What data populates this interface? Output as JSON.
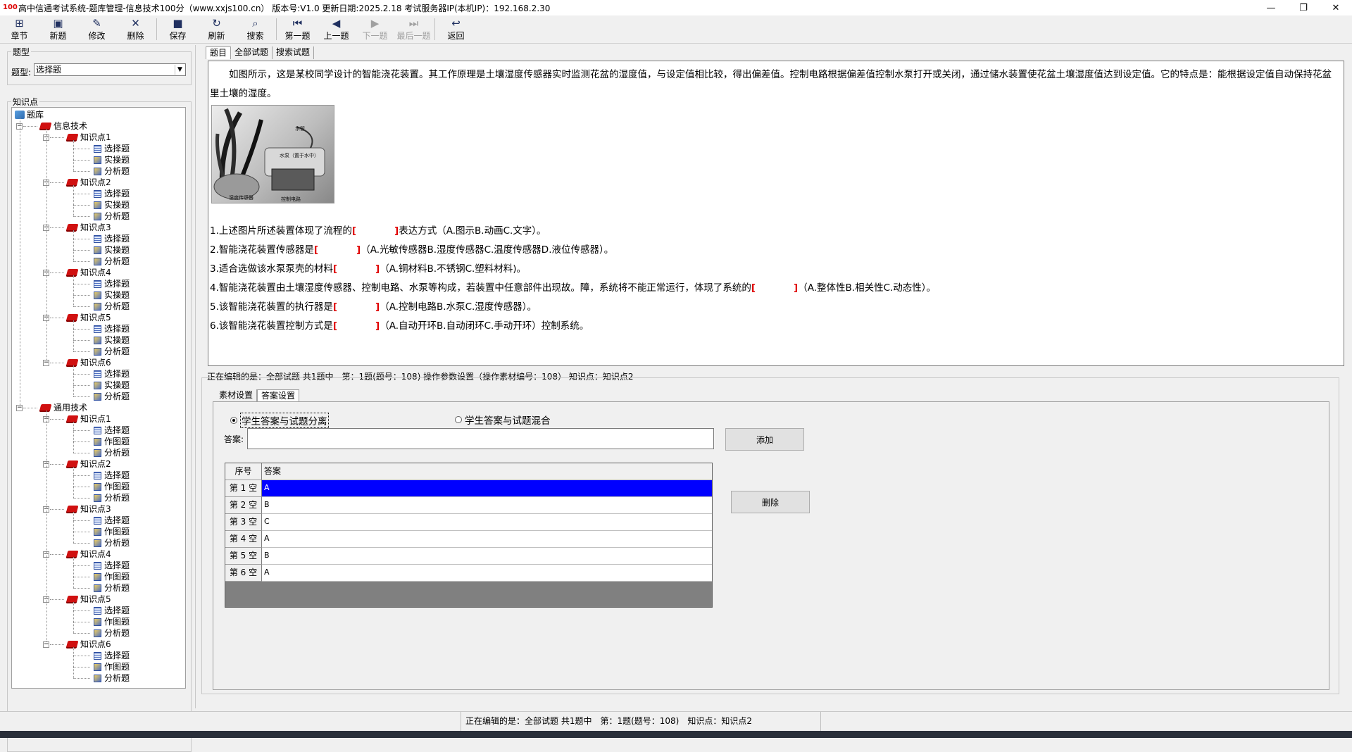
{
  "window": {
    "title": "高中信通考试系统-题库管理-信息技术100分（www.xxjs100.cn） 版本号:V1.0 更新日期:2025.2.18 考试服务器IP(本机IP)：192.168.2.30",
    "logo_text": "100",
    "minimize": "—",
    "maximize": "❐",
    "close": "✕"
  },
  "toolbar": {
    "items": [
      {
        "label": "章节",
        "icon": "chapter-icon",
        "glyph": "⊞"
      },
      {
        "label": "新题",
        "icon": "new-icon",
        "glyph": "▣"
      },
      {
        "label": "修改",
        "icon": "edit-icon",
        "glyph": "✎"
      },
      {
        "label": "删除",
        "icon": "delete-icon",
        "glyph": "✕"
      },
      {
        "label": "保存",
        "icon": "save-icon",
        "glyph": "■"
      },
      {
        "label": "刷新",
        "icon": "refresh-icon",
        "glyph": "↻"
      },
      {
        "label": "搜索",
        "icon": "search-icon",
        "glyph": "⌕"
      },
      {
        "label": "第一题",
        "icon": "first-icon",
        "glyph": "⏮"
      },
      {
        "label": "上一题",
        "icon": "prev-icon",
        "glyph": "◀"
      },
      {
        "label": "下一题",
        "icon": "next-icon",
        "glyph": "▶",
        "disabled": true
      },
      {
        "label": "最后一题",
        "icon": "last-icon",
        "glyph": "⏭",
        "disabled": true
      },
      {
        "label": "返回",
        "icon": "back-icon",
        "glyph": "↩"
      }
    ]
  },
  "left": {
    "type_group_label": "题型",
    "type_field_label": "题型:",
    "type_selected": "选择题",
    "knowledge_group_label": "知识点",
    "tree": {
      "root": "题库",
      "subjects": [
        {
          "name": "信息技术",
          "points": [
            {
              "name": "知识点1",
              "leaves": [
                "选择题",
                "实操题",
                "分析题"
              ]
            },
            {
              "name": "知识点2",
              "leaves": [
                "选择题",
                "实操题",
                "分析题"
              ]
            },
            {
              "name": "知识点3",
              "leaves": [
                "选择题",
                "实操题",
                "分析题"
              ]
            },
            {
              "name": "知识点4",
              "leaves": [
                "选择题",
                "实操题",
                "分析题"
              ]
            },
            {
              "name": "知识点5",
              "leaves": [
                "选择题",
                "实操题",
                "分析题"
              ]
            },
            {
              "name": "知识点6",
              "leaves": [
                "选择题",
                "实操题",
                "分析题"
              ]
            }
          ]
        },
        {
          "name": "通用技术",
          "points": [
            {
              "name": "知识点1",
              "leaves": [
                "选择题",
                "作图题",
                "分析题"
              ]
            },
            {
              "name": "知识点2",
              "leaves": [
                "选择题",
                "作图题",
                "分析题"
              ]
            },
            {
              "name": "知识点3",
              "leaves": [
                "选择题",
                "作图题",
                "分析题"
              ]
            },
            {
              "name": "知识点4",
              "leaves": [
                "选择题",
                "作图题",
                "分析题"
              ]
            },
            {
              "name": "知识点5",
              "leaves": [
                "选择题",
                "作图题",
                "分析题"
              ]
            },
            {
              "name": "知识点6",
              "leaves": [
                "选择题",
                "作图题",
                "分析题"
              ]
            }
          ]
        }
      ]
    }
  },
  "main_tabs": [
    "题目",
    "全部试题",
    "搜索试题"
  ],
  "question": {
    "intro": "如图所示，这是某校同学设计的智能浇花装置。其工作原理是土壤湿度传感器实时监测花盆的湿度值，与设定值相比较，得出偏差值。控制电路根据偏差值控制水泵打开或关闭，通过储水装置使花盆土壤湿度值达到设定值。它的特点是：能根据设定值自动保持花盆里土壤的湿度。",
    "image_captions": [
      "水管",
      "水泵（置于水中）",
      "湿度传感器",
      "控制电路"
    ],
    "items": [
      {
        "pre": "1.上述图片所述装置体现了流程的",
        "blank": "[　　　　]",
        "post": "表达方式（A.图示B.动画C.文字）。"
      },
      {
        "pre": "2.智能浇花装置传感器是",
        "blank": "[　　　　]",
        "post": "（A.光敏传感器B.湿度传感器C.温度传感器D.液位传感器）。"
      },
      {
        "pre": "3.适合选做该水泵泵壳的材料",
        "blank": "[　　　　]",
        "post": "（A.铜材料B.不锈钢C.塑料材料)。"
      },
      {
        "pre": "4.智能浇花装置由土壤湿度传感器、控制电路、水泵等构成，若装置中任意部件出现故。障，系统将不能正常运行，体现了系统的",
        "blank": "[　　　　]",
        "post": "（A.整体性B.相关性C.动态性）。"
      },
      {
        "pre": "5.该智能浇花装置的执行器是",
        "blank": "[　　　　]",
        "post": "（A.控制电路B.水泵C.湿度传感器）。"
      },
      {
        "pre": "6.该智能浇花装置控制方式是",
        "blank": "[　　　　]",
        "post": "（A.自动开环B.自动闭环C.手动开环）控制系统。"
      }
    ]
  },
  "editing_status": "正在编辑的是：全部试题 共1题中　第：1题(题号：108) 操作参数设置（操作素材编号：108） 知识点：知识点2",
  "sub_tabs": [
    "素材设置",
    "答案设置"
  ],
  "answer_settings": {
    "radio_separate": "学生答案与试题分离",
    "radio_mixed": "学生答案与试题混合",
    "answer_label": "答案:",
    "answer_value": "",
    "add_button": "添加",
    "delete_button": "删除",
    "grid_headers": [
      "序号",
      "答案"
    ],
    "rows": [
      {
        "no": "第 1 空",
        "answer": "A"
      },
      {
        "no": "第 2 空",
        "answer": "B"
      },
      {
        "no": "第 3 空",
        "answer": "C"
      },
      {
        "no": "第 4 空",
        "answer": "A"
      },
      {
        "no": "第 5 空",
        "answer": "B"
      },
      {
        "no": "第 6 空",
        "answer": "A"
      }
    ]
  },
  "bottom_status": "正在编辑的是：全部试题 共1题中　第：1题(题号：108)　知识点：知识点2"
}
